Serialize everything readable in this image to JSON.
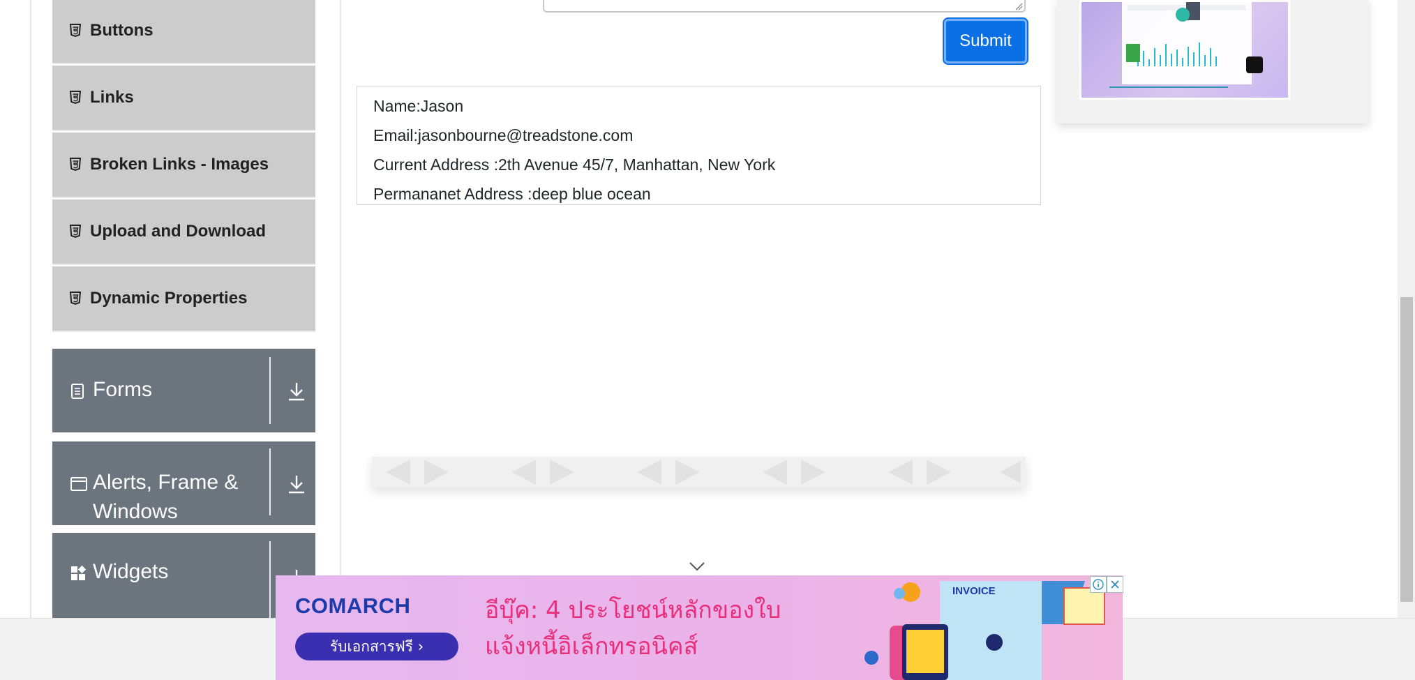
{
  "sidebar": {
    "element_items": [
      {
        "label": "Buttons"
      },
      {
        "label": "Links"
      },
      {
        "label": "Broken Links - Images"
      },
      {
        "label": "Upload and Download"
      },
      {
        "label": "Dynamic Properties"
      }
    ],
    "groups": [
      {
        "label": "Forms"
      },
      {
        "label_line1": "Alerts, Frame &",
        "label_line2": "Windows"
      },
      {
        "label": "Widgets"
      }
    ]
  },
  "form": {
    "submit_label": "Submit"
  },
  "output": {
    "name": "Name:Jason",
    "email": "Email:jasonbourne@treadstone.com",
    "current_address": "Current Address :2th Avenue 45/7, Manhattan, New York",
    "permanent_address": "Permananet Address :deep blue ocean"
  },
  "banner_ad": {
    "brand": "COMARCH",
    "cta": "รับเอกสารฟรี ›",
    "headline_line1": "อีบุ๊ค: 4 ประโยชน์หลักของใบ",
    "headline_line2": "แจ้งหนี้อิเล็กทรอนิคส์",
    "invoice_tag": "INVOICE"
  },
  "colors": {
    "sidebar_item_bg": "#cccccc",
    "group_bg": "#6c757d",
    "submit_bg": "#0b6fe6",
    "banner_text": "#e8307a",
    "brand_blue": "#1c3aa9"
  }
}
